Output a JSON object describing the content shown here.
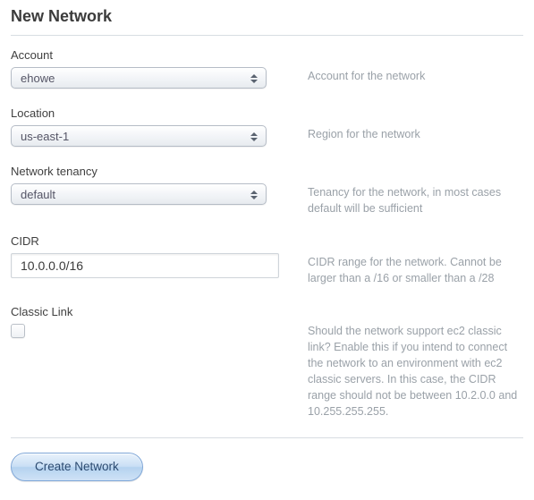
{
  "title": "New Network",
  "fields": {
    "account": {
      "label": "Account",
      "value": "ehowe",
      "help": "Account for the network"
    },
    "location": {
      "label": "Location",
      "value": "us-east-1",
      "help": "Region for the network"
    },
    "tenancy": {
      "label": "Network tenancy",
      "value": "default",
      "help": "Tenancy for the network, in most cases default will be sufficient"
    },
    "cidr": {
      "label": "CIDR",
      "value": "10.0.0.0/16",
      "help": "CIDR range for the network. Cannot be larger than a /16 or smaller than a /28"
    },
    "classic_link": {
      "label": "Classic Link",
      "checked": false,
      "help": "Should the network support ec2 classic link? Enable this if you intend to connect the network to an environment with ec2 classic servers. In this case, the CIDR range should not be between 10.2.0.0 and 10.255.255.255."
    }
  },
  "actions": {
    "submit_label": "Create Network"
  }
}
